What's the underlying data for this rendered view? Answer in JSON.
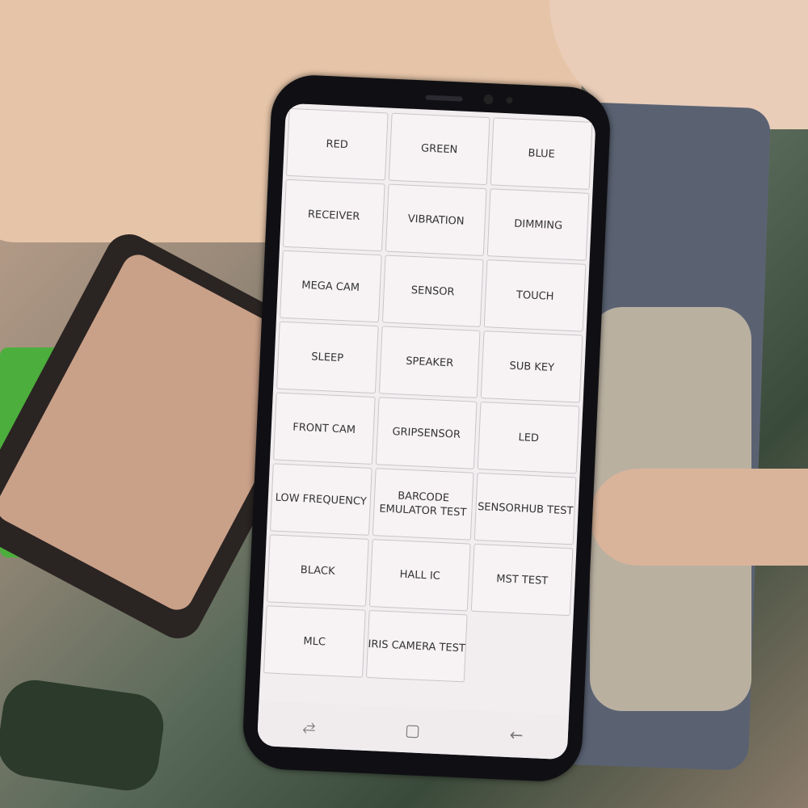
{
  "test_menu": {
    "buttons": [
      "RED",
      "GREEN",
      "BLUE",
      "RECEIVER",
      "VIBRATION",
      "DIMMING",
      "MEGA CAM",
      "SENSOR",
      "TOUCH",
      "SLEEP",
      "SPEAKER",
      "SUB KEY",
      "FRONT CAM",
      "GRIPSENSOR",
      "LED",
      "LOW FREQUENCY",
      "BARCODE EMULATOR TEST",
      "SENSORHUB TEST",
      "BLACK",
      "HALL IC",
      "MST TEST",
      "MLC",
      "IRIS CAMERA TEST"
    ]
  },
  "nav_bar": {
    "icons": [
      "recent-apps-icon",
      "home-icon",
      "back-icon"
    ],
    "glyphs": [
      "⥄",
      "▢",
      "←"
    ]
  }
}
